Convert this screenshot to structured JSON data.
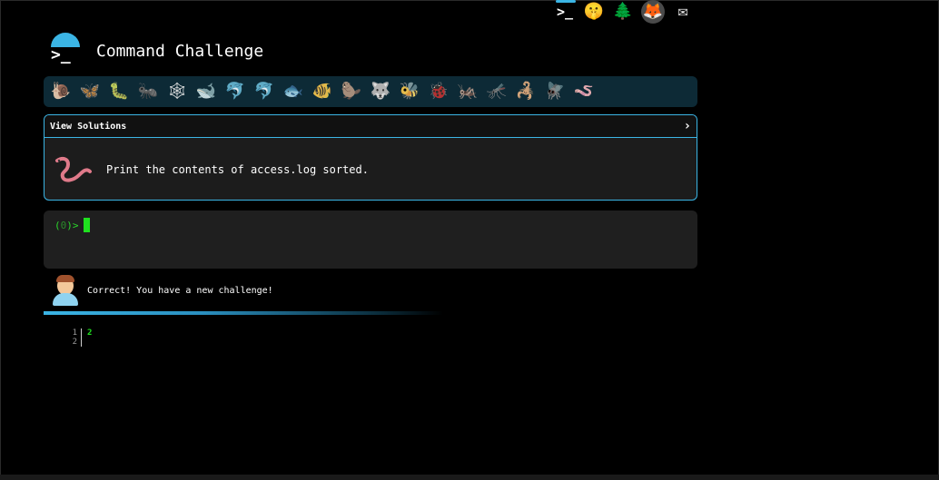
{
  "header": {
    "title": "Command Challenge"
  },
  "top_icons": [
    {
      "name": "terminal-icon",
      "glyph": ">_"
    },
    {
      "name": "shush-face-icon",
      "glyph": "🤫"
    },
    {
      "name": "tree-icon",
      "glyph": "🌲"
    },
    {
      "name": "gitlab-icon",
      "glyph": "🦊"
    },
    {
      "name": "mail-icon",
      "glyph": "✉"
    }
  ],
  "animals": [
    "🐌",
    "🦋",
    "🐛",
    "🐜",
    "🕸",
    "🐋",
    "🐬",
    "🐬",
    "🐟",
    "🐠",
    "🦫",
    "🐺",
    "🐝",
    "🐞",
    "🦗",
    "🦟",
    "🦂",
    "🪰",
    "🪱"
  ],
  "challenge": {
    "header_label": "View Solutions",
    "chevron": "›",
    "text": "Print the contents of access.log sorted."
  },
  "terminal": {
    "prompt_open": "(",
    "prompt_num": "0",
    "prompt_close": ")>"
  },
  "message": {
    "text": "Correct! You have a new challenge!"
  },
  "output": {
    "line_numbers": [
      "1",
      "2"
    ],
    "lines": [
      "2",
      ""
    ]
  },
  "colors": {
    "accent": "#3bb5e5",
    "prompt_green": "#1fe01f",
    "background": "#000000"
  }
}
